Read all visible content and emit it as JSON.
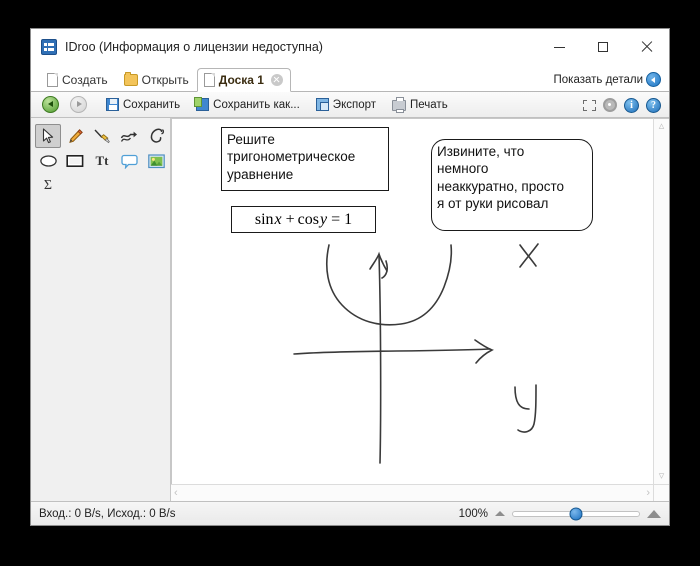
{
  "window": {
    "title": "IDroo (Информация о лицензии недоступна)",
    "app_icon": "idroo-app-icon",
    "controls": {
      "minimize": "minimize-icon",
      "maximize": "maximize-icon",
      "close": "close-icon"
    }
  },
  "tabstrip": {
    "new_label": "Создать",
    "open_label": "Открыть",
    "active_tab_label": "Доска 1",
    "details_label": "Показать детали"
  },
  "toolbar": {
    "back": "back-icon",
    "forward": "forward-icon",
    "save_label": "Сохранить",
    "save_as_label": "Сохранить как...",
    "export_label": "Экспорт",
    "print_label": "Печать",
    "fullscreen": "fullscreen-icon",
    "settings": "gear-icon",
    "info": "i",
    "help": "?"
  },
  "palette": {
    "tools": [
      {
        "name": "select-tool",
        "selected": true
      },
      {
        "name": "pencil-tool",
        "selected": false
      },
      {
        "name": "brush-tool",
        "selected": false
      },
      {
        "name": "polyline-tool",
        "selected": false
      },
      {
        "name": "curve-tool",
        "selected": false
      },
      {
        "name": "ellipse-tool",
        "selected": false
      },
      {
        "name": "rectangle-tool",
        "selected": false
      },
      {
        "name": "text-tool",
        "selected": false,
        "glyph": "Tt"
      },
      {
        "name": "callout-tool",
        "selected": false
      },
      {
        "name": "image-tool",
        "selected": false
      },
      {
        "name": "formula-tool",
        "selected": false,
        "glyph": "Σ"
      }
    ]
  },
  "canvas": {
    "note_task": "Решите\nтригонометрическое\nуравнение",
    "note_sorry": "Извините, что\nнемного\nнеаккуратно, просто\nя от руки рисовал",
    "formula": {
      "full": "sin x + cos y = 1",
      "sin": "sin",
      "var_x": "x",
      "plus": "+",
      "cos": "cos",
      "var_y": "y",
      "equals": "= 1"
    },
    "sketch": {
      "axis_label_x": "x",
      "axis_label_y": "y",
      "description": "hand-drawn coordinate axes with arrows and a parabola"
    },
    "scroll": {
      "up": "▲",
      "down": "▼",
      "left": "‹",
      "right": "›"
    }
  },
  "statusbar": {
    "traffic": "Вход.: 0 B/s, Исход.: 0 B/s",
    "zoom_value": "100%",
    "zoom_out_icon": "zoom-out-icon",
    "zoom_in_icon": "zoom-in-icon"
  },
  "colors": {
    "accent": "#1f6fba",
    "titlebar": "#ffffff",
    "chrome": "#f0f0f0",
    "canvas": "#ffffff",
    "ink": "#333333"
  }
}
